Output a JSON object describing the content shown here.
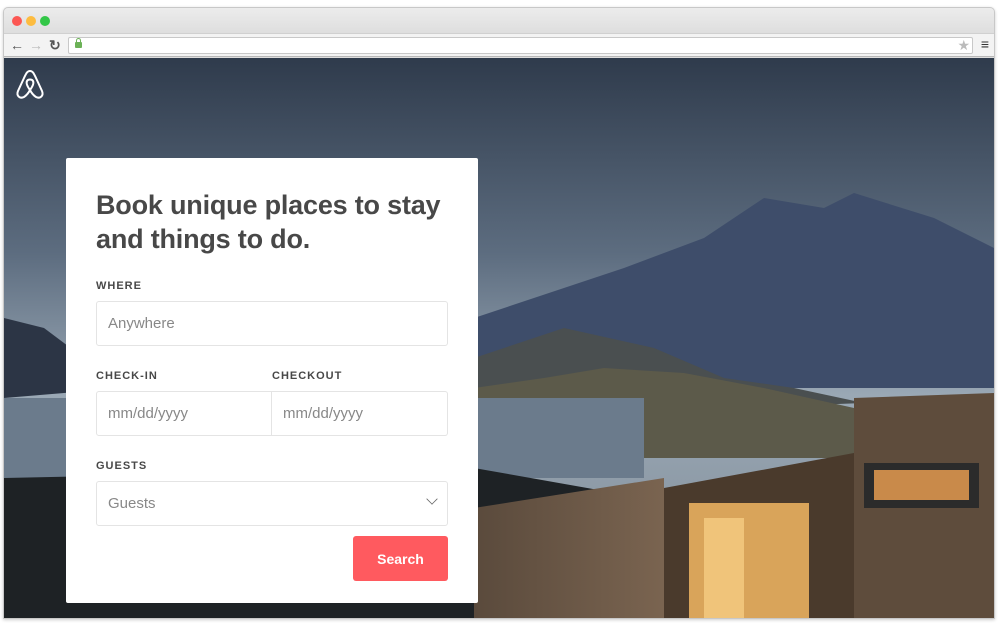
{
  "browser": {
    "url": "",
    "controls": [
      "close",
      "minimize",
      "maximize"
    ]
  },
  "brand": {
    "logo": "airbnb-logo",
    "accent": "#ff5a5f"
  },
  "card": {
    "title": "Book unique places to stay and things to do.",
    "where_label": "WHERE",
    "where_placeholder": "Anywhere",
    "checkin_label": "CHECK-IN",
    "checkin_placeholder": "mm/dd/yyyy",
    "checkout_label": "CHECKOUT",
    "checkout_placeholder": "mm/dd/yyyy",
    "guests_label": "GUESTS",
    "guests_value": "Guests",
    "search_label": "Search"
  }
}
